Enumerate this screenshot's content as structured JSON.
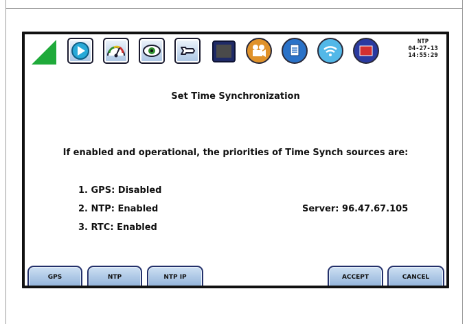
{
  "status": {
    "source": "NTP",
    "date": "04-27-13",
    "time": "14:55:29"
  },
  "toolbar": {
    "icons": [
      "signal-strength-icon",
      "play-icon",
      "gauge-icon",
      "eye-icon",
      "wrench-icon",
      "monitor-icon",
      "camera-icon",
      "document-icon",
      "wifi-icon",
      "screen-icon"
    ]
  },
  "main": {
    "title": "Set Time Synchronization",
    "intro": "If enabled and operational, the priorities of Time Synch sources are:",
    "priorities": [
      "1. GPS: Disabled",
      "2. NTP: Enabled",
      "3. RTC: Enabled"
    ],
    "server": "Server: 96.47.67.105"
  },
  "buttons": {
    "gps": "GPS",
    "ntp": "NTP",
    "ntp_ip": "NTP IP",
    "accept": "ACCEPT",
    "cancel": "CANCEL"
  },
  "colors": {
    "bezel": "#111111",
    "button_fill": "#a9c4e3",
    "button_border": "#23306a",
    "signal_green": "#1faa3a"
  }
}
